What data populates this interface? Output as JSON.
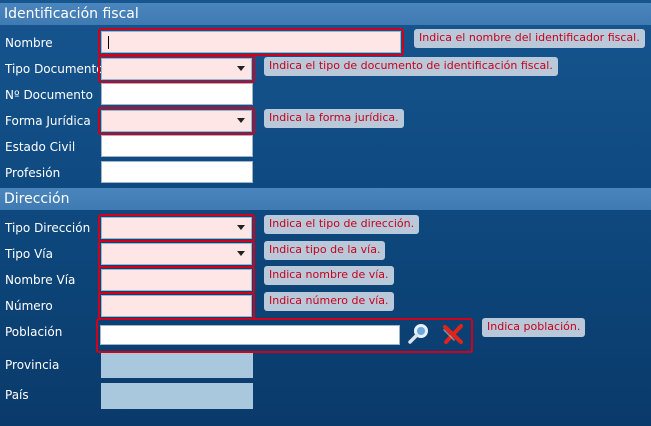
{
  "sections": {
    "fiscal": "Identificación fiscal",
    "direccion": "Dirección"
  },
  "fiscal": {
    "nombre": {
      "label": "Nombre",
      "value": "",
      "tip": "Indica el nombre del identificador fiscal."
    },
    "tipo_documento": {
      "label": "Tipo Documento",
      "value": "",
      "tip": "Indica el tipo de documento de identificación fiscal."
    },
    "n_documento": {
      "label": "Nº Documento",
      "value": ""
    },
    "forma_juridica": {
      "label": "Forma Jurídica",
      "value": "",
      "tip": "Indica la forma jurídica."
    },
    "estado_civil": {
      "label": "Estado Civil",
      "value": ""
    },
    "profesion": {
      "label": "Profesión",
      "value": ""
    }
  },
  "direccion": {
    "tipo_direccion": {
      "label": "Tipo Dirección",
      "value": "",
      "tip": "Indica el tipo de dirección."
    },
    "tipo_via": {
      "label": "Tipo Vía",
      "value": "",
      "tip": "Indica tipo de la vía."
    },
    "nombre_via": {
      "label": "Nombre Vía",
      "value": "",
      "tip": "Indica nombre de vía."
    },
    "numero": {
      "label": "Número",
      "value": "",
      "tip": "Indica número de vía."
    },
    "poblacion": {
      "label": "Población",
      "value": "",
      "tip": "Indica población."
    },
    "provincia": {
      "label": "Provincia",
      "value": ""
    },
    "pais": {
      "label": "País",
      "value": ""
    }
  },
  "icons": {
    "search": "magnifier-icon",
    "clear": "red-x-icon"
  },
  "colors": {
    "required_frame": "#d0021b",
    "tip_text": "#c8001a",
    "tip_bg": "#b9c9da",
    "header_bg": "#4a86bd"
  }
}
